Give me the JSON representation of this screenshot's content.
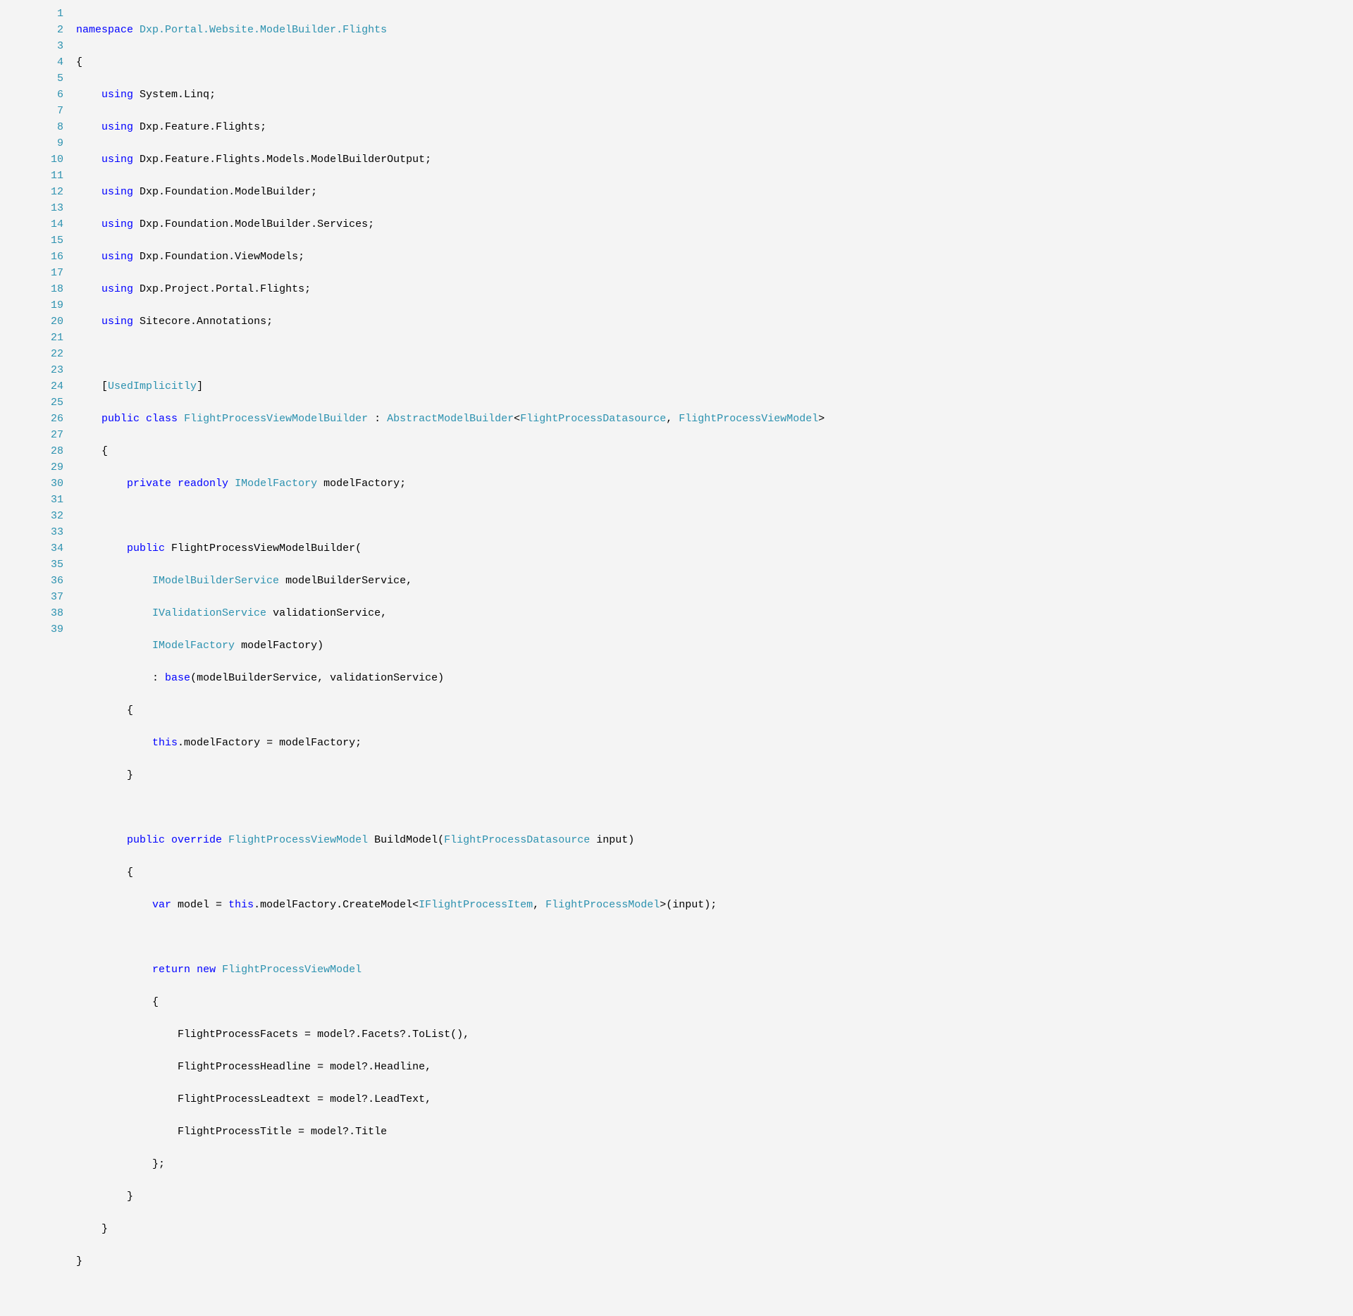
{
  "lineNumbers": [
    "1",
    "2",
    "3",
    "4",
    "5",
    "6",
    "7",
    "8",
    "9",
    "10",
    "11",
    "12",
    "13",
    "14",
    "15",
    "16",
    "17",
    "18",
    "19",
    "20",
    "21",
    "22",
    "23",
    "24",
    "25",
    "26",
    "27",
    "28",
    "29",
    "30",
    "31",
    "32",
    "33",
    "34",
    "35",
    "36",
    "37",
    "38",
    "39"
  ],
  "code": {
    "l1": {
      "kw_namespace": "namespace",
      "ns": "Dxp.Portal.Website.ModelBuilder.Flights"
    },
    "l2": {
      "brace": "{"
    },
    "l3": {
      "kw_using": "using",
      "ns": "System.Linq;"
    },
    "l4": {
      "kw_using": "using",
      "ns": "Dxp.Feature.Flights;"
    },
    "l5": {
      "kw_using": "using",
      "ns": "Dxp.Feature.Flights.Models.ModelBuilderOutput;"
    },
    "l6": {
      "kw_using": "using",
      "ns": "Dxp.Foundation.ModelBuilder;"
    },
    "l7": {
      "kw_using": "using",
      "ns": "Dxp.Foundation.ModelBuilder.Services;"
    },
    "l8": {
      "kw_using": "using",
      "ns": "Dxp.Foundation.ViewModels;"
    },
    "l9": {
      "kw_using": "using",
      "ns": "Dxp.Project.Portal.Flights;"
    },
    "l10": {
      "kw_using": "using",
      "ns": "Sitecore.Annotations;"
    },
    "l12": {
      "open": "[",
      "attr": "UsedImplicitly",
      "close": "]"
    },
    "l13": {
      "kw_public": "public",
      "kw_class": "class",
      "name": "FlightProcessViewModelBuilder",
      "colon": " : ",
      "base": "AbstractModelBuilder",
      "lt": "<",
      "g1": "FlightProcessDatasource",
      "comma": ", ",
      "g2": "FlightProcessViewModel",
      "gt": ">"
    },
    "l14": {
      "brace": "{"
    },
    "l15": {
      "kw_private": "private",
      "kw_readonly": "readonly",
      "type": "IModelFactory",
      "name": "modelFactory;"
    },
    "l17": {
      "kw_public": "public",
      "name": "FlightProcessViewModelBuilder("
    },
    "l18": {
      "type": "IModelBuilderService",
      "name": "modelBuilderService,"
    },
    "l19": {
      "type": "IValidationService",
      "name": "validationService,"
    },
    "l20": {
      "type": "IModelFactory",
      "name": "modelFactory)"
    },
    "l21": {
      "colon": ": ",
      "kw_base": "base",
      "rest": "(modelBuilderService, validationService)"
    },
    "l22": {
      "brace": "{"
    },
    "l23": {
      "kw_this": "this",
      "rest": ".modelFactory = modelFactory;"
    },
    "l24": {
      "brace": "}"
    },
    "l26": {
      "kw_public": "public",
      "kw_override": "override",
      "ret": "FlightProcessViewModel",
      "name": "BuildModel(",
      "ptype": "FlightProcessDatasource",
      "pname": " input)"
    },
    "l27": {
      "brace": "{"
    },
    "l28": {
      "kw_var": "var",
      "eq": " model = ",
      "kw_this": "this",
      "mid": ".modelFactory.CreateModel<",
      "g1": "IFlightProcessItem",
      "comma": ", ",
      "g2": "FlightProcessModel",
      "end": ">(input);"
    },
    "l30": {
      "kw_return": "return",
      "kw_new": "new",
      "type": "FlightProcessViewModel"
    },
    "l31": {
      "brace": "{"
    },
    "l32": {
      "txt": "FlightProcessFacets = model?.Facets?.ToList(),"
    },
    "l33": {
      "txt": "FlightProcessHeadline = model?.Headline,"
    },
    "l34": {
      "txt": "FlightProcessLeadtext = model?.LeadText,"
    },
    "l35": {
      "txt": "FlightProcessTitle = model?.Title"
    },
    "l36": {
      "brace": "};"
    },
    "l37": {
      "brace": "}"
    },
    "l38": {
      "brace": "}"
    },
    "l39": {
      "brace": "}"
    }
  }
}
